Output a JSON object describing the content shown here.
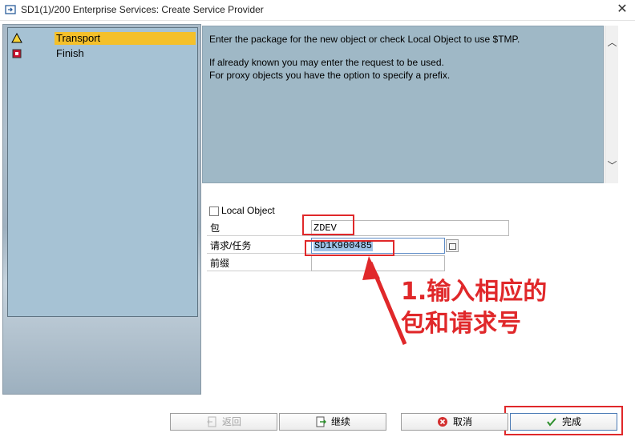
{
  "window": {
    "title": "SD1(1)/200 Enterprise Services: Create Service Provider",
    "close_glyph": "✕"
  },
  "steps": [
    {
      "label": "Transport",
      "icon": "warning-triangle-icon",
      "active": true
    },
    {
      "label": "Finish",
      "icon": "red-stop-icon",
      "active": false
    }
  ],
  "info": {
    "line1": "Enter the package for the new object or check Local Object to use $TMP.",
    "line2": "If already known you may enter the request to be used.",
    "line3": "For proxy objects you have the option to specify a prefix."
  },
  "form": {
    "local_object_label": "Local Object",
    "local_object_checked": false,
    "package_label": "包",
    "package_value": "ZDEV",
    "request_label": "请求/任务",
    "request_value": "SD1K900485",
    "prefix_label": "前缀",
    "prefix_value": ""
  },
  "annotation": {
    "line1": "1.输入相应的",
    "line2": "包和请求号",
    "color": "#e0282a"
  },
  "buttons": {
    "back": "返回",
    "continue": "继续",
    "cancel": "取消",
    "finish": "完成"
  }
}
